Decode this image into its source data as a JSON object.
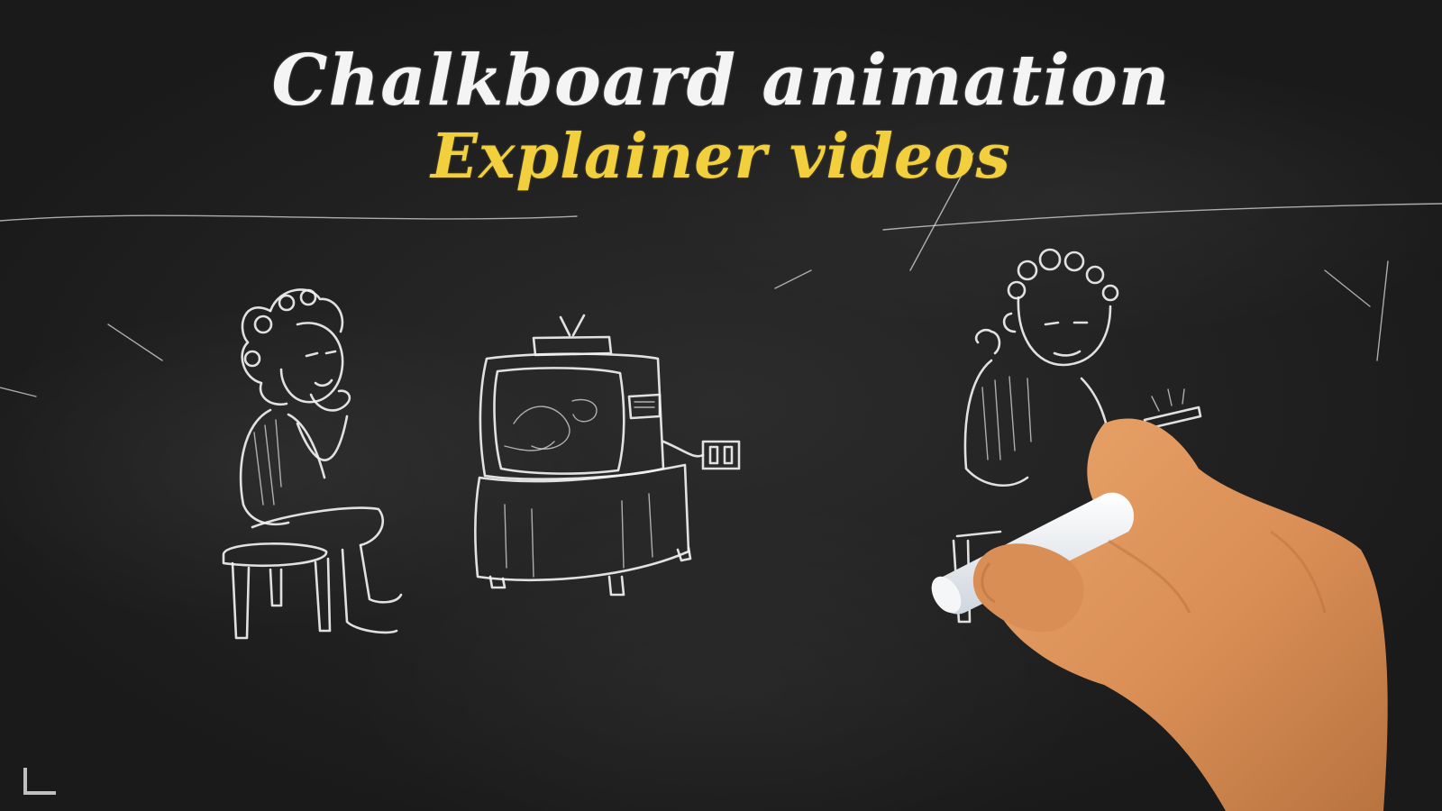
{
  "title": {
    "line1": "Chalkboard animation",
    "line2": "Explainer videos"
  },
  "colors": {
    "board": "#222222",
    "chalk": "#f1f1f1",
    "accent": "#f2cf3c",
    "skin": "#d9925a"
  },
  "icons": {
    "corner_mark": "corner-bracket-icon"
  }
}
